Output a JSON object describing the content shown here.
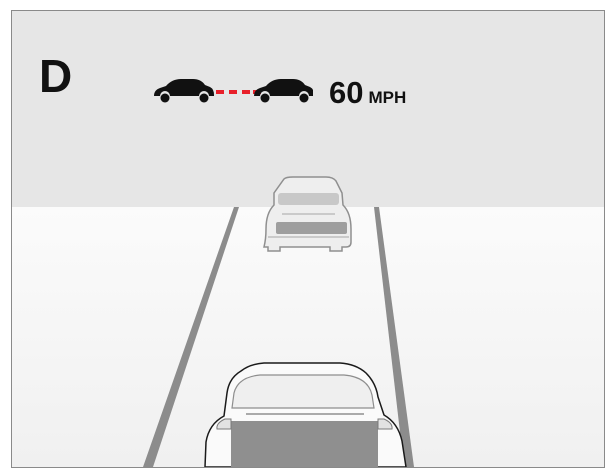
{
  "cluster": {
    "gear": "D",
    "speed_value": "60",
    "speed_unit": "MPH",
    "distance_bar_color": "#e8202a",
    "icons": {
      "follow_car": "car-silhouette-icon",
      "lead_car": "car-silhouette-icon",
      "ahead_vehicle": "vehicle-ahead-icon",
      "own_vehicle": "own-vehicle-icon"
    }
  }
}
